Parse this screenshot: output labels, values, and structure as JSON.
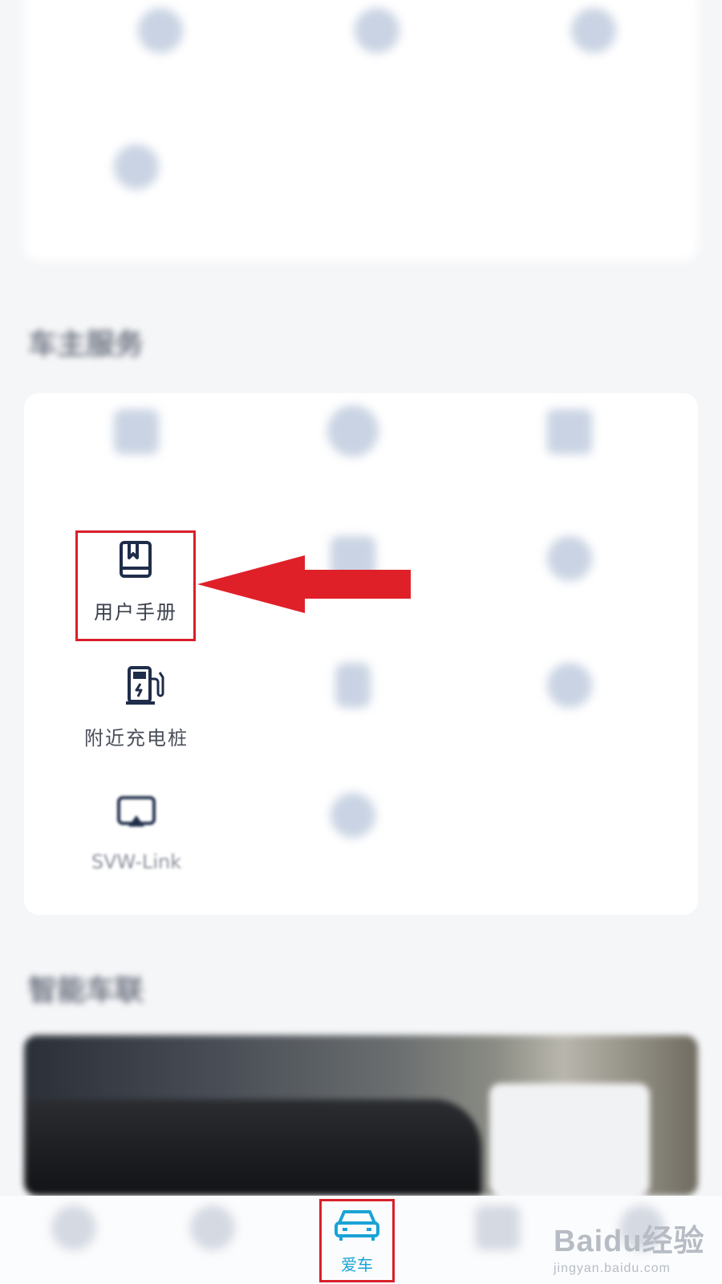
{
  "sections": {
    "services_title": "车主服务",
    "interconnect_title": "智能车联"
  },
  "service_grid": {
    "user_manual": "用户手册",
    "nearby_charging": "附近充电桩",
    "svw_link": "SVW-Link"
  },
  "bottom_nav": {
    "active_tab": "爱车"
  },
  "watermark": {
    "brand": "Baidu经验",
    "url": "jingyan.baidu.com"
  },
  "colors": {
    "highlight": "#d8202a",
    "accent": "#1aa3d6",
    "icon_dark": "#1f2d4a"
  }
}
